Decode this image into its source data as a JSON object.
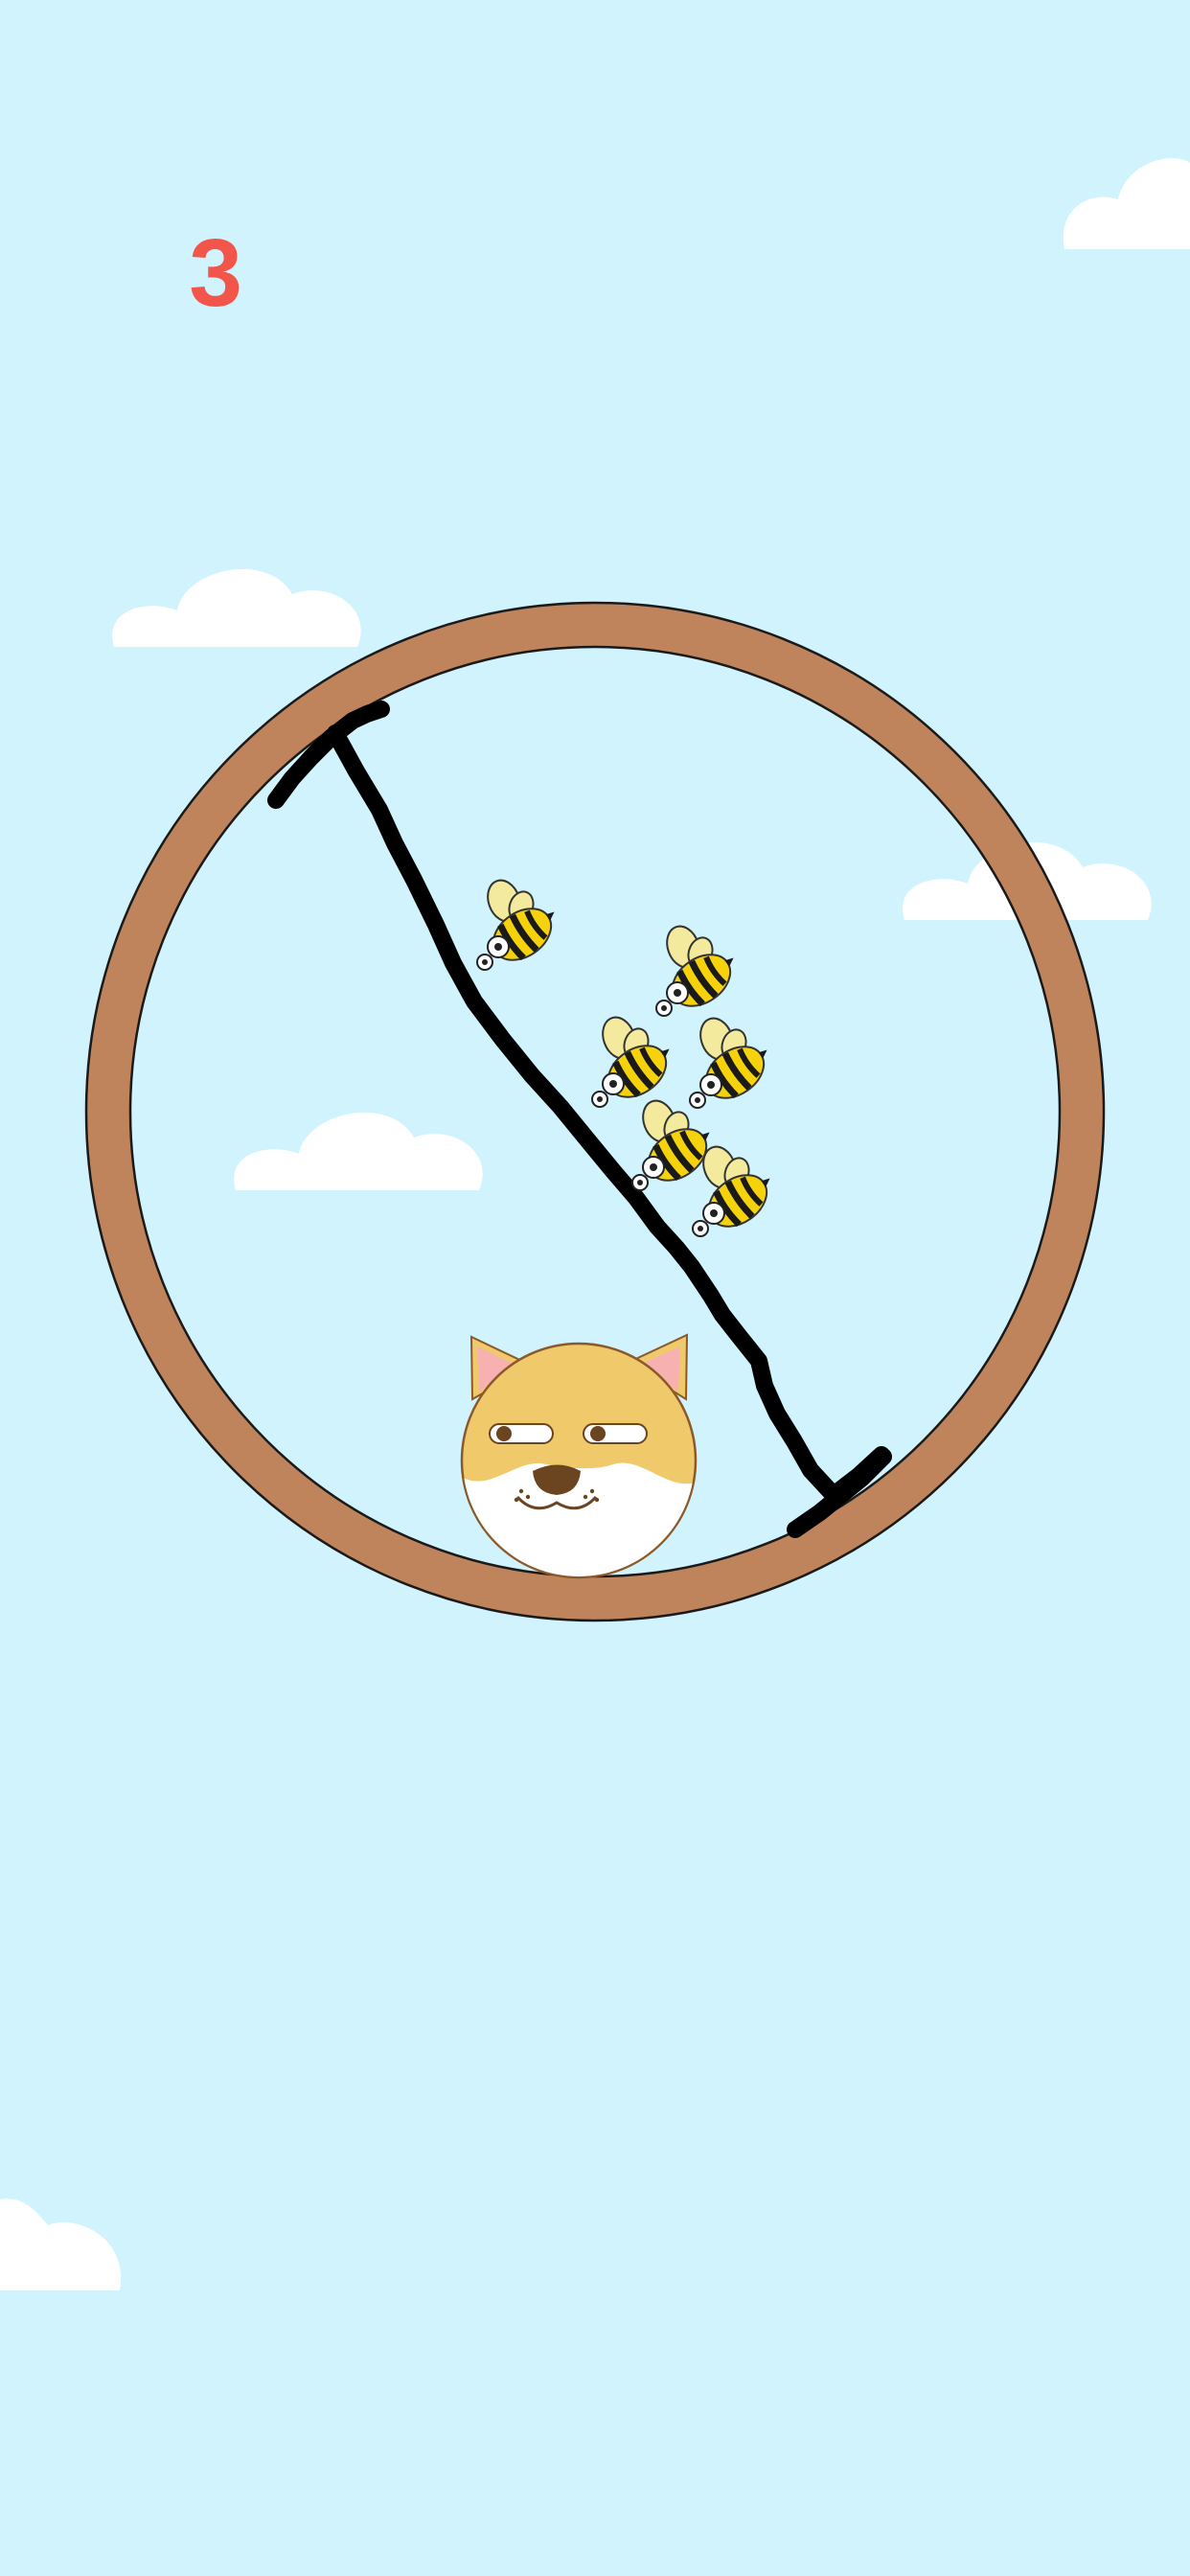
{
  "hud": {
    "countdown": "3",
    "countdown_color": "#f2554a"
  },
  "colors": {
    "sky": "#d0f3fd",
    "cloud": "#ffffff",
    "ring": "#c0845c",
    "ink_line": "#000000",
    "dog_fur": "#f0c96a",
    "dog_face_white": "#ffffff",
    "dog_ear_inner": "#f6b1b0",
    "dog_nose": "#6b4420",
    "bee_yellow": "#f5d20c",
    "bee_stripe": "#1a1a1a",
    "bee_wing": "#f3ea9d"
  },
  "scene": {
    "bee_count": 7,
    "character": "shiba-dog",
    "enemy": "bee",
    "container": "circular-ring"
  }
}
